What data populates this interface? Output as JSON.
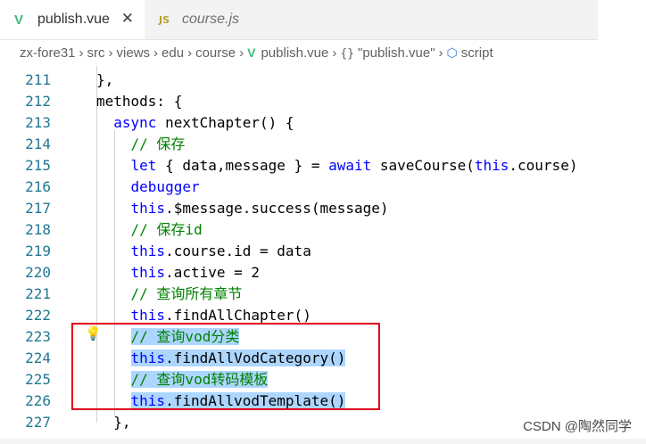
{
  "tabs": [
    {
      "label": "publish.vue",
      "icon": "vue-icon",
      "active": true
    },
    {
      "label": "course.js",
      "icon": "js-icon",
      "active": false
    }
  ],
  "tab_js_badge": "JS",
  "tab_vue_badge": "V",
  "close_glyph": "✕",
  "breadcrumb": {
    "items": [
      "zx-fore31",
      "src",
      "views",
      "edu",
      "course",
      "publish.vue",
      "\"publish.vue\"",
      "script"
    ],
    "brace_glyph": "{}",
    "separator": "›"
  },
  "code": {
    "lines": [
      {
        "no": "211",
        "text": "},"
      },
      {
        "no": "212",
        "text": "methods: {"
      },
      {
        "no": "213",
        "pre": "  ",
        "kw": "async",
        "post": " nextChapter() {"
      },
      {
        "no": "214",
        "pre": "    ",
        "comment": "// 保存"
      },
      {
        "no": "215",
        "pre": "    ",
        "kw": "let",
        "mid": " { data,message } = ",
        "kw2": "await",
        "mid2": " saveCourse(",
        "kw3": "this",
        "post": ".course)"
      },
      {
        "no": "216",
        "pre": "    ",
        "kw": "debugger"
      },
      {
        "no": "217",
        "pre": "    ",
        "kw": "this",
        "post": ".$message.success(message)"
      },
      {
        "no": "218",
        "pre": "    ",
        "comment": "// 保存id"
      },
      {
        "no": "219",
        "pre": "    ",
        "kw": "this",
        "post": ".course.id = data"
      },
      {
        "no": "220",
        "pre": "    ",
        "kw": "this",
        "post": ".active = 2"
      },
      {
        "no": "221",
        "pre": "    ",
        "comment": "// 查询所有章节"
      },
      {
        "no": "222",
        "pre": "    ",
        "kw": "this",
        "post": ".findAllChapter()"
      },
      {
        "no": "223",
        "pre": "    ",
        "comment": "// 查询vod分类",
        "selected": true
      },
      {
        "no": "224",
        "pre": "    ",
        "kw": "this",
        "post": ".findAllVodCategory()",
        "selected": true
      },
      {
        "no": "225",
        "pre": "    ",
        "comment": "// 查询vod转码模板",
        "selected": true
      },
      {
        "no": "226",
        "pre": "    ",
        "kw": "this",
        "post": ".findAllvodTemplate()",
        "selected": true
      },
      {
        "no": "227",
        "pre": "  ",
        "text": "},"
      }
    ]
  },
  "bulb_glyph": "💡",
  "watermark": "CSDN @陶然同学",
  "colors": {
    "keyword": "#0000ff",
    "comment": "#008000",
    "line_number": "#237893",
    "selection": "#add6ff",
    "annotation_box": "#e0001b",
    "vue": "#41b883"
  }
}
